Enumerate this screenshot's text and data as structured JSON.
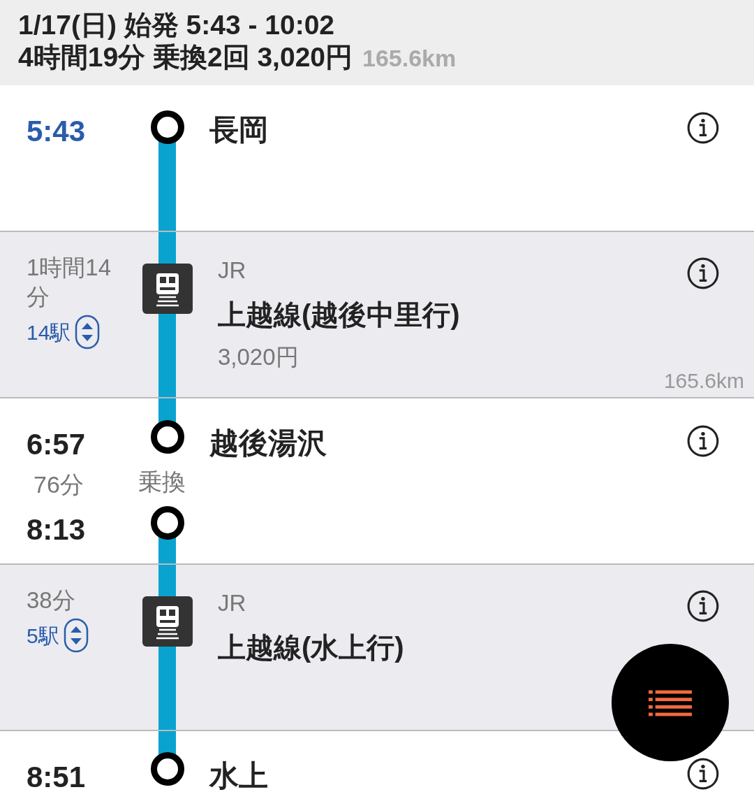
{
  "header": {
    "date_line": "1/17(日) 始発 5:43 - 10:02",
    "summary": "4時間19分 乗換2回 3,020円",
    "distance": "165.6km"
  },
  "timeline": [
    {
      "kind": "station",
      "time": "5:43",
      "current": true,
      "name": "長岡"
    },
    {
      "kind": "segment",
      "duration": "1時間14分",
      "stops": "14駅",
      "operator": "JR",
      "line": "上越線(越後中里行)",
      "fare": "3,020円",
      "distance": "165.6km"
    },
    {
      "kind": "transfer",
      "arrive": "6:57",
      "name": "越後湯沢",
      "wait": "76分",
      "label": "乗換",
      "depart": "8:13"
    },
    {
      "kind": "segment",
      "duration": "38分",
      "stops": "5駅",
      "operator": "JR",
      "line": "上越線(水上行)"
    },
    {
      "kind": "station",
      "time": "8:51",
      "current": false,
      "name": "水上"
    }
  ]
}
